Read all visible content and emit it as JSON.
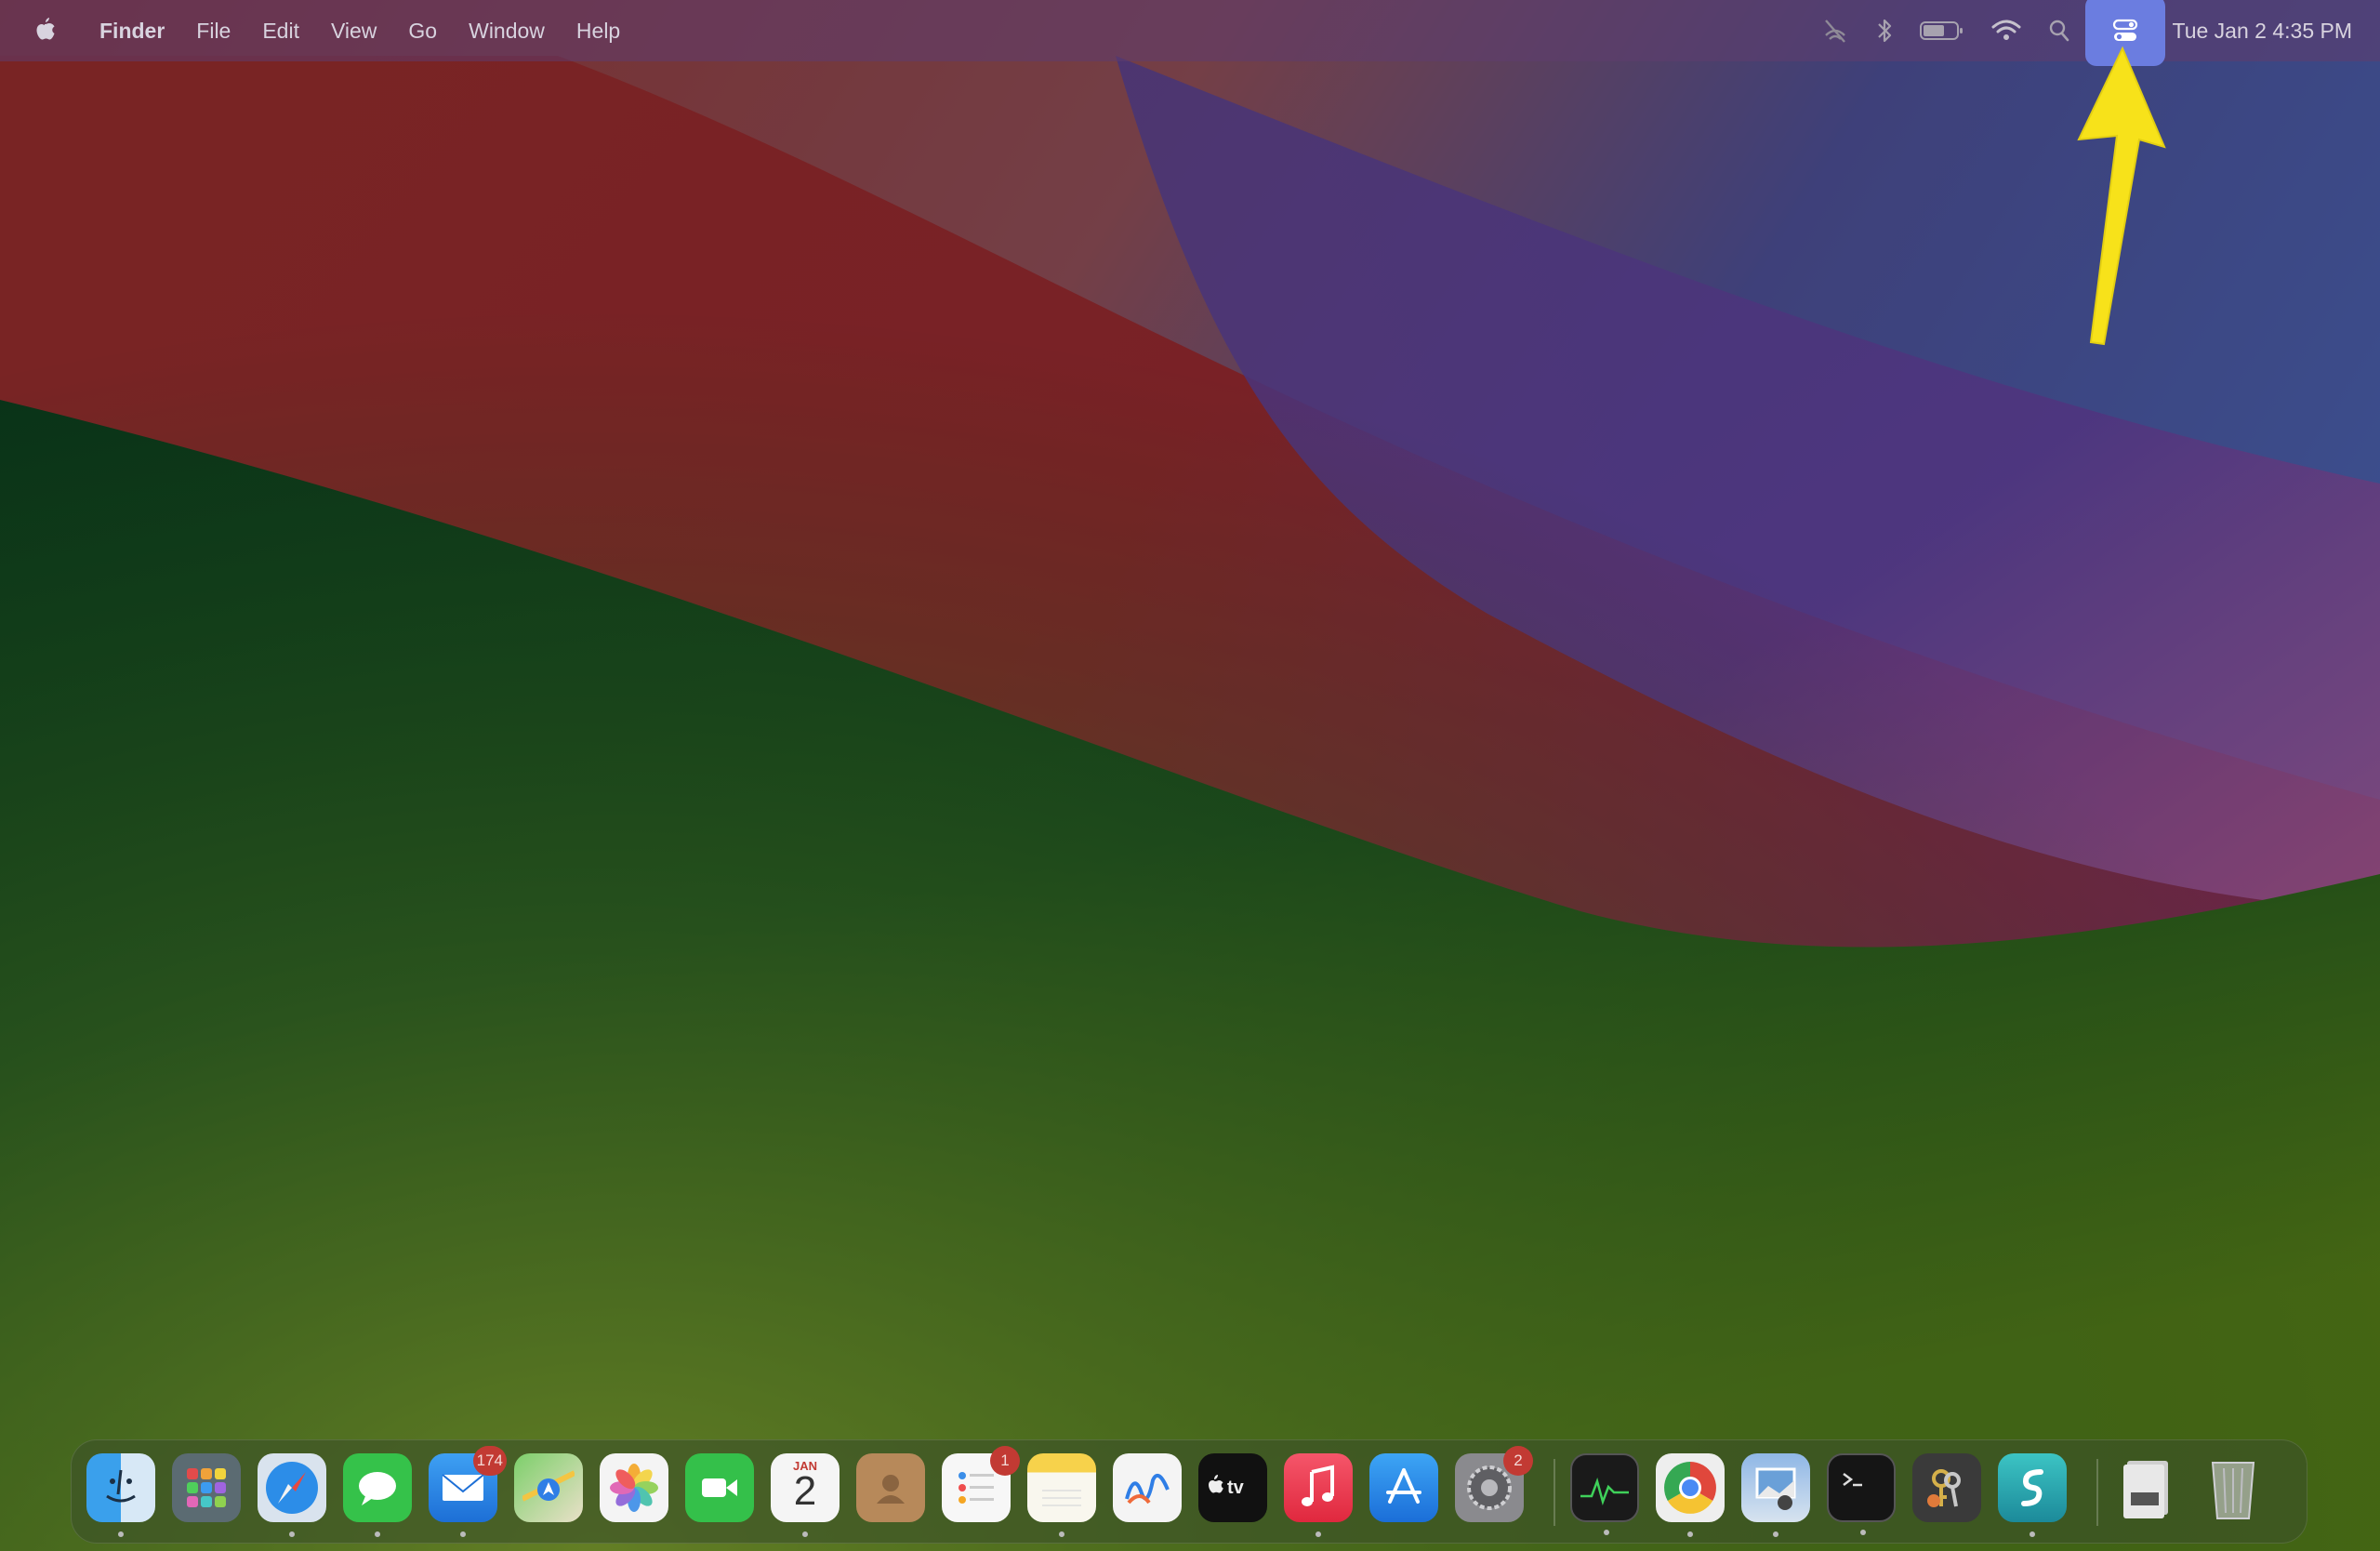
{
  "menubar": {
    "apple_icon": "apple-logo-icon",
    "app_name": "Finder",
    "menus": [
      "File",
      "Edit",
      "View",
      "Go",
      "Window",
      "Help"
    ],
    "status_icons": [
      "slashed-signal-icon",
      "bluetooth-icon",
      "battery-icon",
      "wifi-icon",
      "spotlight-search-icon",
      "control-center-icon"
    ],
    "clock": "Tue Jan 2  4:35 PM"
  },
  "annotation": {
    "arrow_color": "#f7e21a",
    "points_to": "control-center-icon"
  },
  "dock": {
    "apps": [
      {
        "name": "Finder",
        "icon": "finder-icon",
        "running": true
      },
      {
        "name": "Launchpad",
        "icon": "launchpad-icon",
        "running": false
      },
      {
        "name": "Safari",
        "icon": "safari-icon",
        "running": true
      },
      {
        "name": "Messages",
        "icon": "messages-icon",
        "running": true
      },
      {
        "name": "Mail",
        "icon": "mail-icon",
        "running": true,
        "badge": "174"
      },
      {
        "name": "Maps",
        "icon": "maps-icon",
        "running": false
      },
      {
        "name": "Photos",
        "icon": "photos-icon",
        "running": false
      },
      {
        "name": "FaceTime",
        "icon": "facetime-icon",
        "running": false
      },
      {
        "name": "Calendar",
        "icon": "calendar-icon",
        "running": true,
        "month": "JAN",
        "day": "2"
      },
      {
        "name": "Contacts",
        "icon": "contacts-icon",
        "running": false
      },
      {
        "name": "Reminders",
        "icon": "reminders-icon",
        "running": false,
        "badge": "1"
      },
      {
        "name": "Notes",
        "icon": "notes-icon",
        "running": true
      },
      {
        "name": "Freeform",
        "icon": "freeform-icon",
        "running": false
      },
      {
        "name": "TV",
        "icon": "apple-tv-icon",
        "running": false
      },
      {
        "name": "Music",
        "icon": "music-icon",
        "running": true
      },
      {
        "name": "App Store",
        "icon": "app-store-icon",
        "running": false
      },
      {
        "name": "System Settings",
        "icon": "system-settings-icon",
        "running": false,
        "badge": "2"
      },
      {
        "name": "Activity Monitor",
        "icon": "activity-monitor-icon",
        "running": true
      },
      {
        "name": "Chrome",
        "icon": "chrome-icon",
        "running": true
      },
      {
        "name": "Preview",
        "icon": "preview-icon",
        "running": true
      },
      {
        "name": "Terminal",
        "icon": "terminal-icon",
        "running": true
      },
      {
        "name": "Keychain Access",
        "icon": "keychain-access-icon",
        "running": false
      },
      {
        "name": "Surfshark",
        "icon": "surfshark-icon",
        "running": true
      },
      {
        "name": "Documents",
        "icon": "documents-folder-icon",
        "running": false
      },
      {
        "name": "Trash",
        "icon": "trash-icon",
        "running": false
      }
    ]
  }
}
